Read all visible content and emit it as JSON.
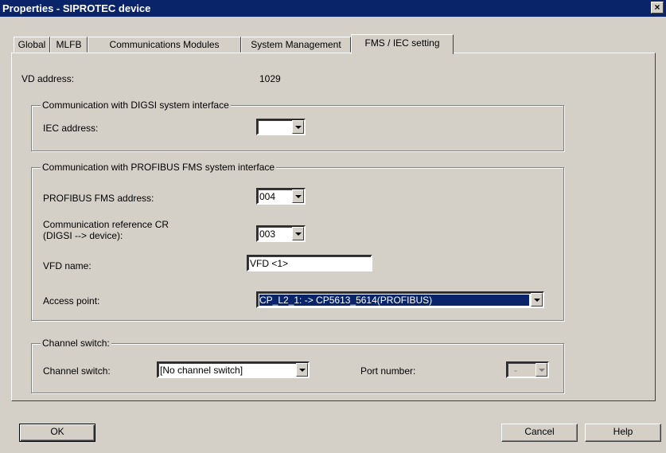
{
  "window": {
    "title": "Properties - SIPROTEC device",
    "close_label": "×"
  },
  "tabs": [
    "Global",
    "MLFB",
    "Communications Modules",
    "System Management",
    "FMS / IEC setting"
  ],
  "vd": {
    "label": "VD address:",
    "value": "1029"
  },
  "digsi_group": {
    "title": "Communication with DIGSI system interface",
    "iec_label": "IEC address:",
    "iec_value": ""
  },
  "fms_group": {
    "title": "Communication with PROFIBUS FMS system interface",
    "fms_address_label": "PROFIBUS FMS address:",
    "fms_address_value": "004",
    "cr_label_line1": "Communication reference CR",
    "cr_label_line2": "(DIGSI --> device):",
    "cr_value": "003",
    "vfd_label": "VFD name:",
    "vfd_value": "VFD <1>",
    "access_label": "Access point:",
    "access_value": "CP_L2_1:   ->   CP5613_5614(PROFIBUS)"
  },
  "channel_group": {
    "title": "Channel switch:",
    "switch_label": "Channel switch:",
    "switch_value": "[No channel switch]",
    "port_label": "Port number:",
    "port_value": "-"
  },
  "buttons": {
    "ok": "OK",
    "cancel": "Cancel",
    "help": "Help"
  },
  "colors": {
    "titlebar": "#0a246a",
    "face": "#d4d0c8",
    "selection": "#0a246a"
  }
}
